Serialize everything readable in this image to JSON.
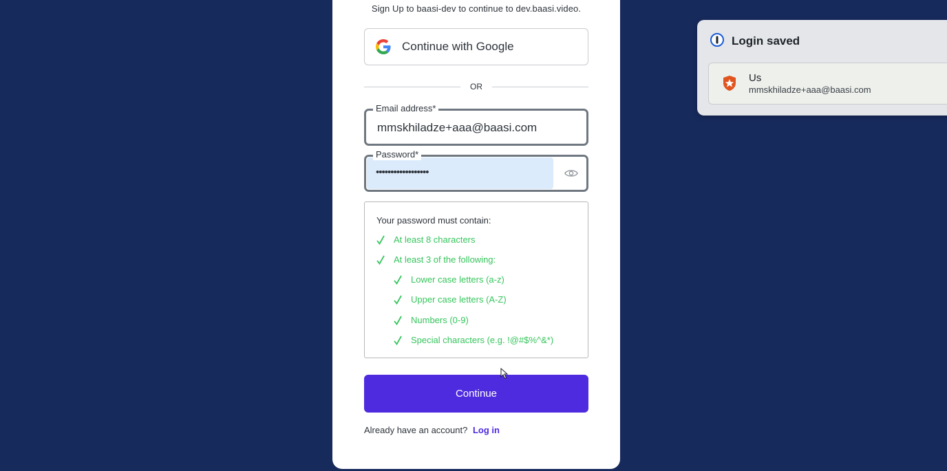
{
  "signup": {
    "subtitle": "Sign Up to baasi-dev to continue to dev.baasi.video.",
    "google_button": "Continue with Google",
    "or_label": "OR",
    "email": {
      "label": "Email address*",
      "value": "mmskhiladze+aaa@baasi.com"
    },
    "password": {
      "label": "Password*",
      "masked_value": "••••••••••••••••••"
    },
    "requirements": {
      "heading": "Your password must contain:",
      "items": [
        "At least 8 characters",
        "At least 3 of the following:",
        "Lower case letters (a-z)",
        "Upper case letters (A-Z)",
        "Numbers (0-9)",
        "Special characters (e.g. !@#$%^&*)"
      ]
    },
    "continue_button": "Continue",
    "footer_text": "Already have an account?",
    "login_link": "Log in"
  },
  "popup": {
    "title": "Login saved",
    "item": {
      "name": "Us",
      "username": "mmskhiladze+aaa@baasi.com"
    }
  },
  "colors": {
    "background": "#172a5c",
    "accent": "#4f2be0",
    "success": "#35c55c",
    "autofill": "#dcebfb"
  }
}
